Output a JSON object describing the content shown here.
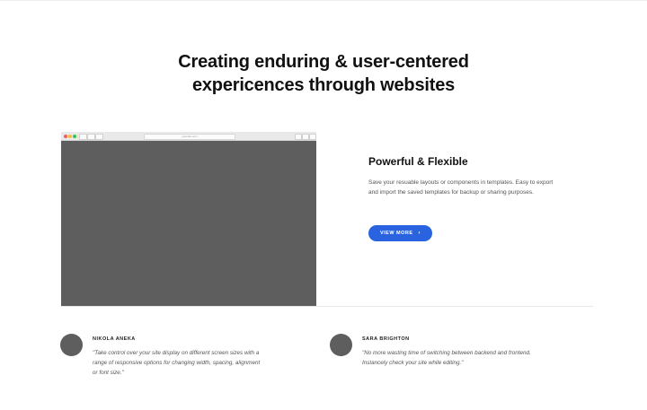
{
  "hero": {
    "title_line1": "Creating enduring & user-centered",
    "title_line2": "expericences through websites"
  },
  "browser_mockup": {
    "address": "yoursite.com"
  },
  "feature": {
    "title": "Powerful & Flexible",
    "description": "Save your resuable layouts or components in templates. Easy to export and import the saved templates for backup or sharing purposes.",
    "button_label": "VIEW MORE",
    "button_icon": "chevron-right-icon",
    "accent_color": "#2a63e0"
  },
  "testimonials": [
    {
      "name": "NIKOLA ANEKA",
      "quote": "\"Take control over your site display on different screen sizes with a range of responsive options for changing width, spacing, alignment or font size.\""
    },
    {
      "name": "SARA BRIGHTON",
      "quote": "\"No more wasting time of switching between backend and frontend. Instancely check your site while editing.\""
    }
  ]
}
